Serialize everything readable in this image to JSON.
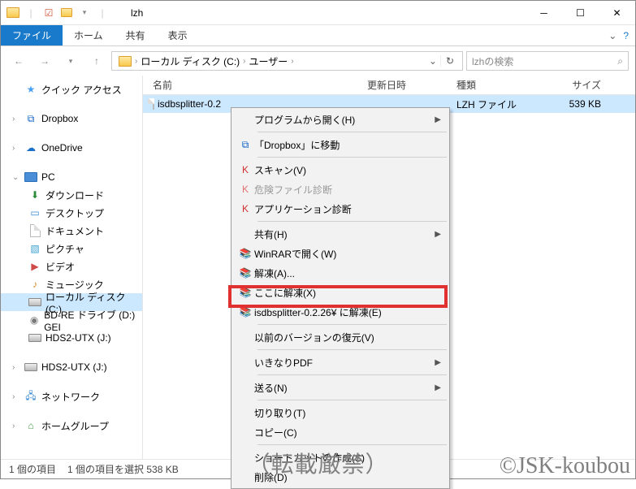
{
  "window_title": "lzh",
  "ribbon": {
    "file": "ファイル",
    "home": "ホーム",
    "share": "共有",
    "view": "表示"
  },
  "breadcrumb": {
    "drive": "ローカル ディスク (C:)",
    "folder": "ユーザー"
  },
  "search_placeholder": "lzhの検索",
  "columns": {
    "name": "名前",
    "date": "更新日時",
    "type": "種類",
    "size": "サイズ"
  },
  "nav": {
    "quick": "クイック アクセス",
    "dropbox": "Dropbox",
    "onedrive": "OneDrive",
    "pc": "PC",
    "downloads": "ダウンロード",
    "desktop": "デスクトップ",
    "documents": "ドキュメント",
    "pictures": "ピクチャ",
    "videos": "ビデオ",
    "music": "ミュージック",
    "localdisk": "ローカル ディスク (C:)",
    "bdre": "BD-RE ドライブ (D:) GEI",
    "hds2_1": "HDS2-UTX (J:)",
    "hds2_2": "HDS2-UTX (J:)",
    "network": "ネットワーク",
    "homegroup": "ホームグループ"
  },
  "file_row": {
    "name": "isdbsplitter-0.2",
    "type": "LZH ファイル",
    "size": "539 KB"
  },
  "context": {
    "open_with": "プログラムから開く(H)",
    "dropbox_move": "「Dropbox」に移動",
    "scan": "スキャン(V)",
    "danger_scan": "危険ファイル診断",
    "app_scan": "アプリケーション診断",
    "share": "共有(H)",
    "winrar_open": "WinRARで開く(W)",
    "extract_a": "解凍(A)...",
    "extract_here": "ここに解凍(X)",
    "extract_to": "isdbsplitter-0.2.26¥ に解凍(E)",
    "prev_version": "以前のバージョンの復元(V)",
    "ikinaripdf": "いきなりPDF",
    "send_to": "送る(N)",
    "cut": "切り取り(T)",
    "copy": "コピー(C)",
    "shortcut": "ショートカットの作成(S)",
    "delete": "削除(D)"
  },
  "status": {
    "count": "1 個の項目",
    "selection": "1 個の項目を選択 538 KB"
  },
  "watermark_center": "（転載厳禁）",
  "watermark_right": "©JSK-koubou"
}
